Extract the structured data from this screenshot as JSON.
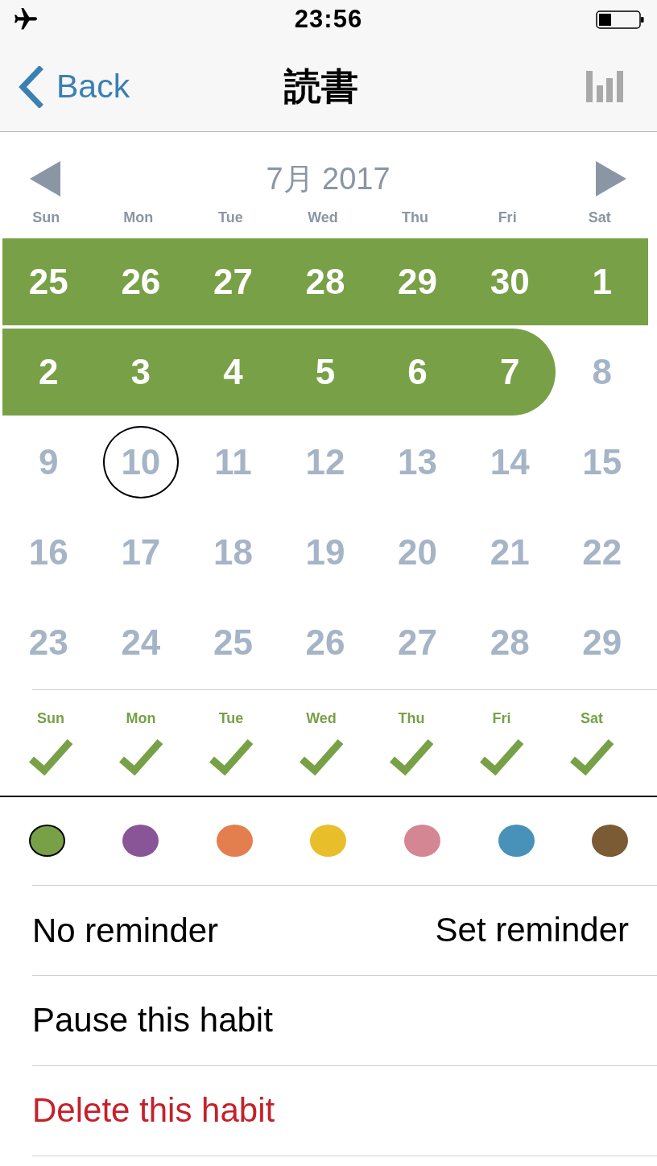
{
  "status_bar": {
    "time": "23:56"
  },
  "nav_bar": {
    "back": "Back",
    "title": "読書"
  },
  "calendar": {
    "month": "7月 2017",
    "weekdays": [
      "Sun",
      "Mon",
      "Tue",
      "Wed",
      "Thu",
      "Fri",
      "Sat"
    ],
    "weeks": [
      [
        {
          "day": "25",
          "done": true,
          "today": false
        },
        {
          "day": "26",
          "done": true,
          "today": false
        },
        {
          "day": "27",
          "done": true,
          "today": false
        },
        {
          "day": "28",
          "done": true,
          "today": false
        },
        {
          "day": "29",
          "done": true,
          "today": false
        },
        {
          "day": "30",
          "done": true,
          "today": false
        },
        {
          "day": "1",
          "done": true,
          "today": false
        }
      ],
      [
        {
          "day": "2",
          "done": true,
          "today": false
        },
        {
          "day": "3",
          "done": true,
          "today": false
        },
        {
          "day": "4",
          "done": true,
          "today": false
        },
        {
          "day": "5",
          "done": true,
          "today": false
        },
        {
          "day": "6",
          "done": true,
          "today": false
        },
        {
          "day": "7",
          "done": true,
          "today": false
        },
        {
          "day": "8",
          "done": false,
          "today": false
        }
      ],
      [
        {
          "day": "9",
          "done": false,
          "today": false
        },
        {
          "day": "10",
          "done": false,
          "today": true
        },
        {
          "day": "11",
          "done": false,
          "today": false
        },
        {
          "day": "12",
          "done": false,
          "today": false
        },
        {
          "day": "13",
          "done": false,
          "today": false
        },
        {
          "day": "14",
          "done": false,
          "today": false
        },
        {
          "day": "15",
          "done": false,
          "today": false
        }
      ],
      [
        {
          "day": "16",
          "done": false,
          "today": false
        },
        {
          "day": "17",
          "done": false,
          "today": false
        },
        {
          "day": "18",
          "done": false,
          "today": false
        },
        {
          "day": "19",
          "done": false,
          "today": false
        },
        {
          "day": "20",
          "done": false,
          "today": false
        },
        {
          "day": "21",
          "done": false,
          "today": false
        },
        {
          "day": "22",
          "done": false,
          "today": false
        }
      ],
      [
        {
          "day": "23",
          "done": false,
          "today": false
        },
        {
          "day": "24",
          "done": false,
          "today": false
        },
        {
          "day": "25",
          "done": false,
          "today": false
        },
        {
          "day": "26",
          "done": false,
          "today": false
        },
        {
          "day": "27",
          "done": false,
          "today": false
        },
        {
          "day": "28",
          "done": false,
          "today": false
        },
        {
          "day": "29",
          "done": false,
          "today": false
        }
      ]
    ]
  },
  "schedule": [
    {
      "day": "Sun",
      "checked": true
    },
    {
      "day": "Mon",
      "checked": true
    },
    {
      "day": "Tue",
      "checked": true
    },
    {
      "day": "Wed",
      "checked": true
    },
    {
      "day": "Thu",
      "checked": true
    },
    {
      "day": "Fri",
      "checked": true
    },
    {
      "day": "Sat",
      "checked": true
    }
  ],
  "colors": [
    {
      "color": "#78a046",
      "selected": true
    },
    {
      "color": "#8a5596",
      "selected": false
    },
    {
      "color": "#e37f4f",
      "selected": false
    },
    {
      "color": "#e8bf2a",
      "selected": false
    },
    {
      "color": "#d48793",
      "selected": false
    },
    {
      "color": "#4891b8",
      "selected": false
    },
    {
      "color": "#7a5b33",
      "selected": false
    }
  ],
  "settings": [
    {
      "kind": "reminder",
      "label": "No reminder",
      "action": "Set reminder"
    },
    {
      "kind": "action",
      "label": "Pause this habit"
    },
    {
      "kind": "destructive",
      "label": "Delete this habit"
    }
  ]
}
